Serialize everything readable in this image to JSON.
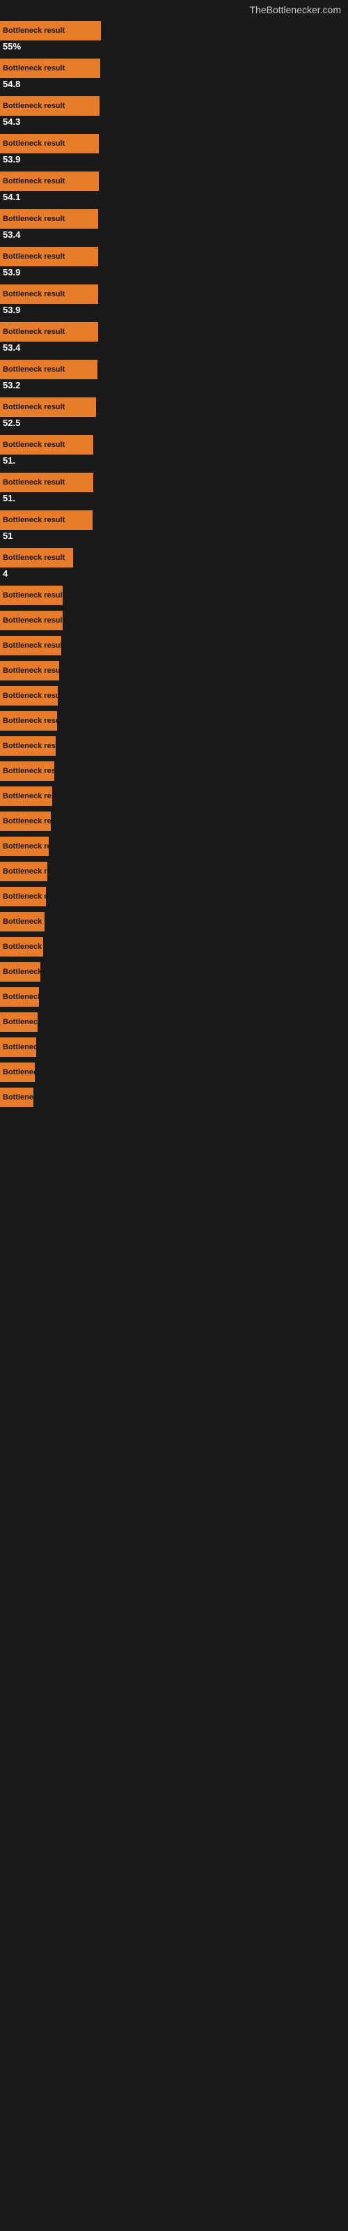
{
  "site": {
    "title": "TheBottlenecker.com"
  },
  "bars": [
    {
      "label": "Bottleneck result",
      "value": "55%",
      "width": 145
    },
    {
      "label": "Bottleneck result",
      "value": "54.8",
      "width": 144
    },
    {
      "label": "Bottleneck result",
      "value": "54.3",
      "width": 143
    },
    {
      "label": "Bottleneck result",
      "value": "53.9",
      "width": 142
    },
    {
      "label": "Bottleneck result",
      "value": "54.1",
      "width": 142
    },
    {
      "label": "Bottleneck result",
      "value": "53.4",
      "width": 141
    },
    {
      "label": "Bottleneck result",
      "value": "53.9",
      "width": 141
    },
    {
      "label": "Bottleneck result",
      "value": "53.9",
      "width": 141
    },
    {
      "label": "Bottleneck result",
      "value": "53.4",
      "width": 141
    },
    {
      "label": "Bottleneck result",
      "value": "53.2",
      "width": 140
    },
    {
      "label": "Bottleneck result",
      "value": "52.5",
      "width": 138
    },
    {
      "label": "Bottleneck result",
      "value": "51.",
      "width": 134
    },
    {
      "label": "Bottleneck result",
      "value": "51.",
      "width": 134
    },
    {
      "label": "Bottleneck result",
      "value": "51",
      "width": 133
    },
    {
      "label": "Bottleneck result",
      "value": "4",
      "width": 105
    },
    {
      "label": "Bottleneck result",
      "value": "",
      "width": 90
    },
    {
      "label": "Bottleneck result",
      "value": "",
      "width": 90
    },
    {
      "label": "Bottleneck result",
      "value": "",
      "width": 88
    },
    {
      "label": "Bottleneck result",
      "value": "",
      "width": 85
    },
    {
      "label": "Bottleneck result",
      "value": "",
      "width": 83
    },
    {
      "label": "Bottleneck result",
      "value": "",
      "width": 82
    },
    {
      "label": "Bottleneck result",
      "value": "",
      "width": 80
    },
    {
      "label": "Bottleneck result",
      "value": "",
      "width": 78
    },
    {
      "label": "Bottleneck result",
      "value": "",
      "width": 75
    },
    {
      "label": "Bottleneck result",
      "value": "",
      "width": 73
    },
    {
      "label": "Bottleneck result",
      "value": "",
      "width": 70
    },
    {
      "label": "Bottleneck resu",
      "value": "",
      "width": 68
    },
    {
      "label": "Bottleneck result",
      "value": "",
      "width": 66
    },
    {
      "label": "Bottleneck result",
      "value": "",
      "width": 64
    },
    {
      "label": "Bottleneck resu",
      "value": "",
      "width": 62
    },
    {
      "label": "Bottleneck re",
      "value": "",
      "width": 58
    },
    {
      "label": "Bottleneck re",
      "value": "",
      "width": 56
    },
    {
      "label": "Bottleneck re",
      "value": "",
      "width": 54
    },
    {
      "label": "Bottleneck re",
      "value": "",
      "width": 52
    },
    {
      "label": "Bottleneck re",
      "value": "",
      "width": 50
    },
    {
      "label": "Bottleneck re",
      "value": "",
      "width": 48
    }
  ]
}
